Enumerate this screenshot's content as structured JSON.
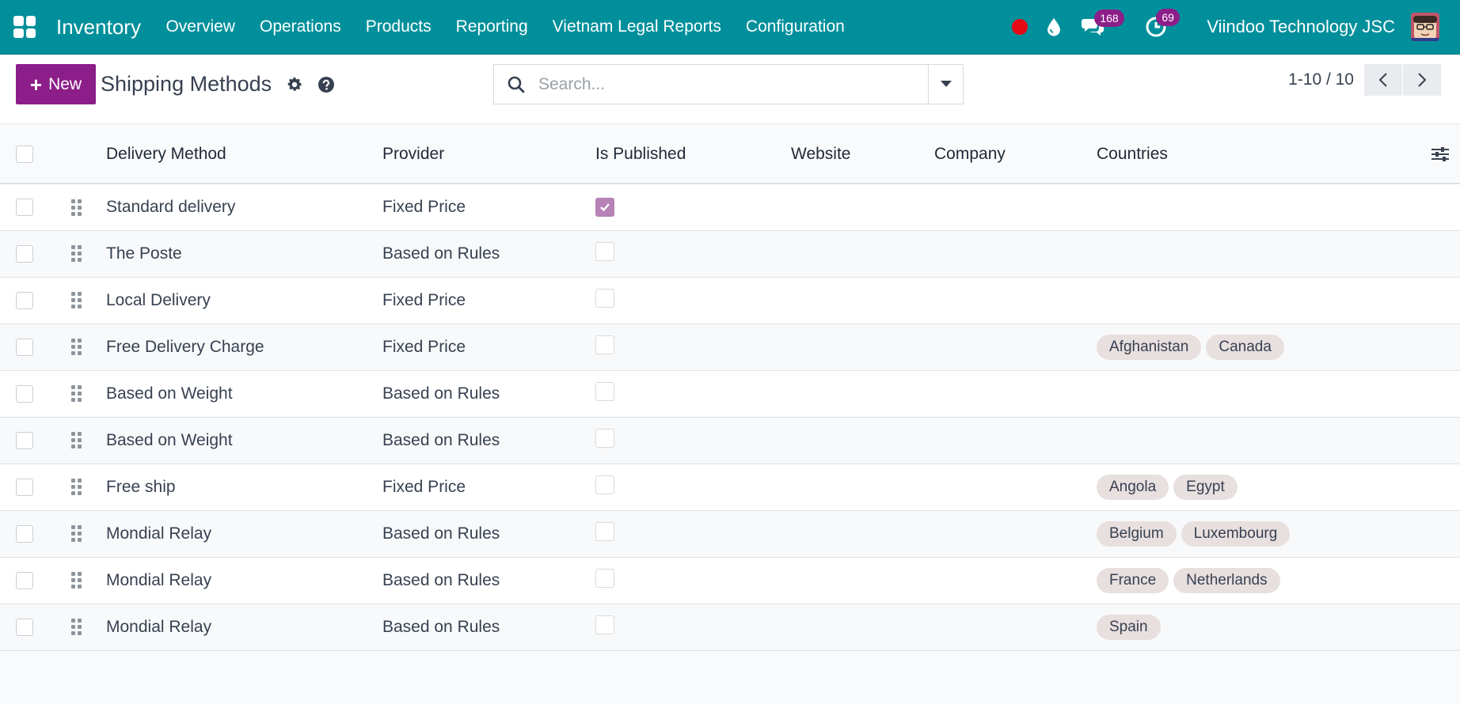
{
  "navbar": {
    "app_title": "Inventory",
    "menu": [
      "Overview",
      "Operations",
      "Products",
      "Reporting",
      "Vietnam Legal Reports",
      "Configuration"
    ],
    "messages_count": "168",
    "activities_count": "69",
    "company": "Viindoo Technology JSC",
    "colors": {
      "bar": "#01909b",
      "badge": "#8c1e8a",
      "record": "#e50914"
    }
  },
  "controlpanel": {
    "new_label": "New",
    "title": "Shipping Methods",
    "search_placeholder": "Search...",
    "pager_value": "1-10 / 10"
  },
  "table": {
    "columns": [
      "Delivery Method",
      "Provider",
      "Is Published",
      "Website",
      "Company",
      "Countries"
    ],
    "rows": [
      {
        "name": "Standard delivery",
        "provider": "Fixed Price",
        "published": true,
        "website": "",
        "company": "",
        "countries": []
      },
      {
        "name": "The Poste",
        "provider": "Based on Rules",
        "published": false,
        "website": "",
        "company": "",
        "countries": []
      },
      {
        "name": "Local Delivery",
        "provider": "Fixed Price",
        "published": false,
        "website": "",
        "company": "",
        "countries": []
      },
      {
        "name": "Free Delivery Charge",
        "provider": "Fixed Price",
        "published": false,
        "website": "",
        "company": "",
        "countries": [
          "Afghanistan",
          "Canada"
        ]
      },
      {
        "name": "Based on Weight",
        "provider": "Based on Rules",
        "published": false,
        "website": "",
        "company": "",
        "countries": []
      },
      {
        "name": "Based on Weight",
        "provider": "Based on Rules",
        "published": false,
        "website": "",
        "company": "",
        "countries": []
      },
      {
        "name": "Free ship",
        "provider": "Fixed Price",
        "published": false,
        "website": "",
        "company": "",
        "countries": [
          "Angola",
          "Egypt"
        ]
      },
      {
        "name": "Mondial Relay",
        "provider": "Based on Rules",
        "published": false,
        "website": "",
        "company": "",
        "countries": [
          "Belgium",
          "Luxembourg"
        ]
      },
      {
        "name": "Mondial Relay",
        "provider": "Based on Rules",
        "published": false,
        "website": "",
        "company": "",
        "countries": [
          "France",
          "Netherlands"
        ]
      },
      {
        "name": "Mondial Relay",
        "provider": "Based on Rules",
        "published": false,
        "website": "",
        "company": "",
        "countries": [
          "Spain"
        ]
      }
    ]
  }
}
